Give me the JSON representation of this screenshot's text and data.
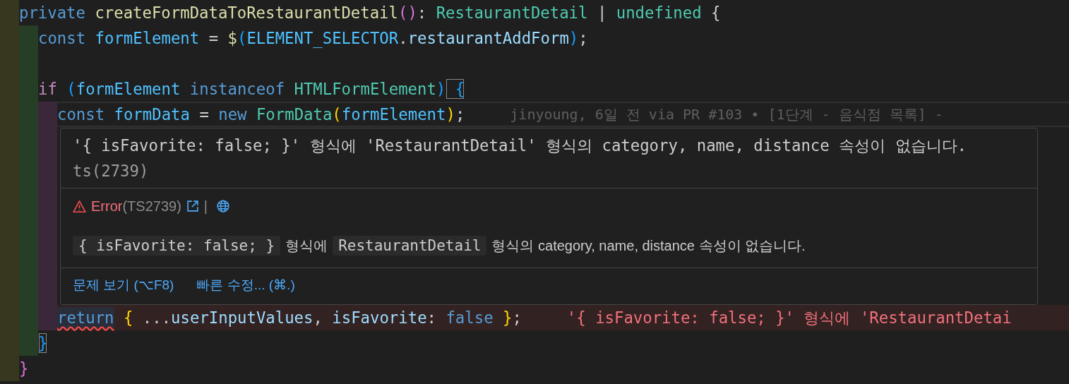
{
  "editor": {
    "lines": [
      {
        "current": false,
        "error": false,
        "tokens": [
          {
            "text": "private",
            "kind": "keyword"
          },
          {
            "text": " createFormDataToRestaurantDetail",
            "kind": "function"
          },
          {
            "text": "()",
            "kind": "bracket-pink"
          },
          {
            "text": ":",
            "kind": "plain"
          },
          {
            "text": " RestaurantDetail",
            "kind": "type"
          },
          {
            "text": " |",
            "kind": "plain"
          },
          {
            "text": " undefined",
            "kind": "type"
          },
          {
            "text": " {",
            "kind": "plain"
          }
        ],
        "children": [
          {
            "current": false,
            "error": false,
            "tokens": [
              {
                "text": "const",
                "kind": "keyword"
              },
              {
                "text": " formElement",
                "kind": "constant"
              },
              {
                "text": " =",
                "kind": "plain"
              },
              {
                "text": " $",
                "kind": "function"
              },
              {
                "text": "(",
                "kind": "bracket-blue"
              },
              {
                "text": "ELEMENT_SELECTOR",
                "kind": "constant"
              },
              {
                "text": ".",
                "kind": "plain"
              },
              {
                "text": "restaurantAddForm",
                "kind": "variable"
              },
              {
                "text": ")",
                "kind": "bracket-blue"
              },
              {
                "text": ";",
                "kind": "plain"
              }
            ]
          },
          {
            "current": false,
            "error": false
          },
          {
            "current": false,
            "error": false,
            "tokens": [
              {
                "text": "if",
                "kind": "control"
              },
              {
                "text": " (",
                "kind": "bracket-blue"
              },
              {
                "text": "formElement",
                "kind": "constant"
              },
              {
                "text": " instanceof",
                "kind": "keyword"
              },
              {
                "text": " HTMLFormElement",
                "kind": "type"
              },
              {
                "text": ")",
                "kind": "bracket-blue"
              },
              {
                "text": " {",
                "kind": "matched-bracket"
              }
            ],
            "children": [
              {
                "current": true,
                "error": false,
                "tokens": [
                  {
                    "text": "const",
                    "kind": "keyword"
                  },
                  {
                    "text": " formData",
                    "kind": "constant"
                  },
                  {
                    "text": " =",
                    "kind": "plain"
                  },
                  {
                    "text": " new",
                    "kind": "keyword"
                  },
                  {
                    "text": " FormData",
                    "kind": "type"
                  },
                  {
                    "text": "(",
                    "kind": "bracket-gold"
                  },
                  {
                    "text": "formElement",
                    "kind": "constant"
                  },
                  {
                    "text": ")",
                    "kind": "bracket-gold"
                  },
                  {
                    "text": ";",
                    "kind": "plain"
                  }
                ],
                "inline": {
                  "kind": "blame",
                  "text": "jinyoung, 6일 전 via PR #103 • [1단계 - 음식점 목록] -"
                }
              },
              {
                "current": false,
                "error": false
              },
              {
                "current": false,
                "error": false
              },
              {
                "current": false,
                "error": false
              },
              {
                "current": false,
                "error": false
              },
              {
                "current": false,
                "error": false
              },
              {
                "current": false,
                "error": false
              },
              {
                "current": false,
                "error": false
              },
              {
                "current": false,
                "error": true,
                "tokens": [
                  {
                    "text": "return",
                    "kind": "error-link"
                  },
                  {
                    "text": " {",
                    "kind": "bracket-gold"
                  },
                  {
                    "text": " ...",
                    "kind": "plain"
                  },
                  {
                    "text": "userInputValues",
                    "kind": "variable"
                  },
                  {
                    "text": ",",
                    "kind": "plain"
                  },
                  {
                    "text": " isFavorite",
                    "kind": "variable"
                  },
                  {
                    "text": ":",
                    "kind": "plain"
                  },
                  {
                    "text": " false",
                    "kind": "keyword"
                  },
                  {
                    "text": " }",
                    "kind": "bracket-gold"
                  },
                  {
                    "text": ";",
                    "kind": "plain"
                  }
                ],
                "inline": {
                  "kind": "error",
                  "text": "'{ isFavorite: false; }' 형식에 'RestaurantDetai"
                }
              }
            ]
          },
          {
            "current": false,
            "error": false,
            "tokens": [
              {
                "text": "}",
                "kind": "matched-bracket"
              }
            ]
          }
        ]
      },
      {
        "current": false,
        "error": false,
        "tokens": [
          {
            "text": "}",
            "kind": "bracket-pink"
          }
        ]
      }
    ]
  },
  "hover": {
    "message": "'{ isFavorite: false; }' 형식에 'RestaurantDetail' 형식의 category, name, distance 속성이 없습니다.",
    "source": "ts(2739)",
    "severity": "Error",
    "code": "(TS2739)",
    "separator": "|",
    "detail": [
      {
        "text": "{ isFavorite: false; }",
        "kind": "code"
      },
      {
        "text": "형식에",
        "kind": "text"
      },
      {
        "text": "RestaurantDetail",
        "kind": "code"
      },
      {
        "text": "형식의 category, name, distance 속성이 없습니다.",
        "kind": "text"
      }
    ],
    "actions": [
      "문제 보기 (⌥F8)",
      "빠른 수정... (⌘.)"
    ]
  }
}
